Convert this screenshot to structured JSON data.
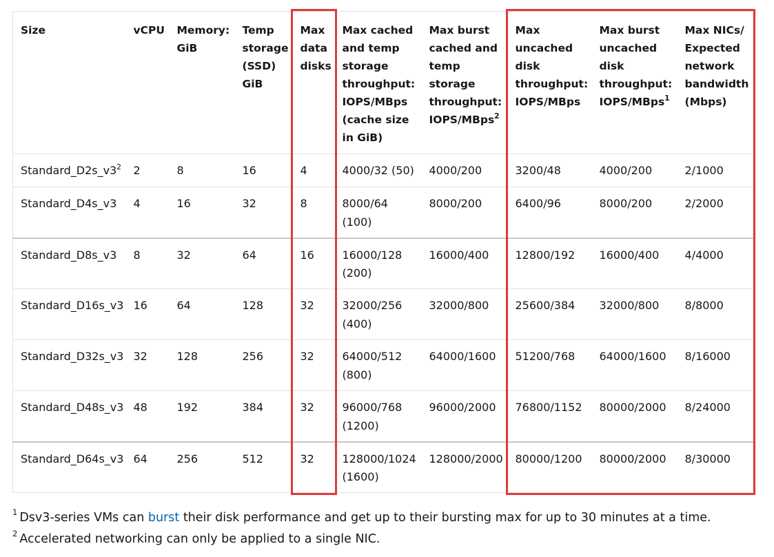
{
  "table": {
    "headers": [
      {
        "text": "Size"
      },
      {
        "text": "vCPU"
      },
      {
        "text": "Memory: GiB"
      },
      {
        "text": "Temp storage (SSD) GiB"
      },
      {
        "text": "Max data disks"
      },
      {
        "text": "Max cached and temp storage throughput: IOPS/MBps (cache size in GiB)"
      },
      {
        "text": "Max burst cached and temp storage throughput: IOPS/MBps",
        "sup": "2"
      },
      {
        "text": "Max uncached disk throughput: IOPS/MBps"
      },
      {
        "text": "Max burst uncached disk throughput: IOPS/MBps",
        "sup": "1"
      },
      {
        "text": "Max NICs/ Expected network bandwidth (Mbps)"
      }
    ],
    "rows": [
      {
        "size": "Standard_D2s_v3",
        "size_sup": "2",
        "vcpu": "2",
        "memory": "8",
        "temp": "16",
        "disks": "4",
        "cached": "4000/32 (50)",
        "burst_cached": "4000/200",
        "uncached": "3200/48",
        "burst_uncached": "4000/200",
        "nics": "2/1000"
      },
      {
        "size": "Standard_D4s_v3",
        "vcpu": "4",
        "memory": "16",
        "temp": "32",
        "disks": "8",
        "cached": "8000/64 (100)",
        "burst_cached": "8000/200",
        "uncached": "6400/96",
        "burst_uncached": "8000/200",
        "nics": "2/2000"
      },
      {
        "size": "Standard_D8s_v3",
        "vcpu": "8",
        "memory": "32",
        "temp": "64",
        "disks": "16",
        "cached": "16000/128 (200)",
        "burst_cached": "16000/400",
        "uncached": "12800/192",
        "burst_uncached": "16000/400",
        "nics": "4/4000"
      },
      {
        "size": "Standard_D16s_v3",
        "vcpu": "16",
        "memory": "64",
        "temp": "128",
        "disks": "32",
        "cached": "32000/256 (400)",
        "burst_cached": "32000/800",
        "uncached": "25600/384",
        "burst_uncached": "32000/800",
        "nics": "8/8000"
      },
      {
        "size": "Standard_D32s_v3",
        "vcpu": "32",
        "memory": "128",
        "temp": "256",
        "disks": "32",
        "cached": "64000/512 (800)",
        "burst_cached": "64000/1600",
        "uncached": "51200/768",
        "burst_uncached": "64000/1600",
        "nics": "8/16000"
      },
      {
        "size": "Standard_D48s_v3",
        "vcpu": "48",
        "memory": "192",
        "temp": "384",
        "disks": "32",
        "cached": "96000/768 (1200)",
        "burst_cached": "96000/2000",
        "uncached": "76800/1152",
        "burst_uncached": "80000/2000",
        "nics": "8/24000"
      },
      {
        "size": "Standard_D64s_v3",
        "vcpu": "64",
        "memory": "256",
        "temp": "512",
        "disks": "32",
        "cached": "128000/1024 (1600)",
        "burst_cached": "128000/2000",
        "uncached": "80000/1200",
        "burst_uncached": "80000/2000",
        "nics": "8/30000"
      }
    ]
  },
  "highlight_color": "#e23a3a",
  "link_color": "#0065b3",
  "footnotes": {
    "n1_marker": "1",
    "n1_before": "Dsv3-series VMs can ",
    "n1_link": "burst",
    "n1_after": " their disk performance and get up to their bursting max for up to 30 minutes at a time.",
    "n2_marker": "2",
    "n2_text": "Accelerated networking can only be applied to a single NIC."
  }
}
